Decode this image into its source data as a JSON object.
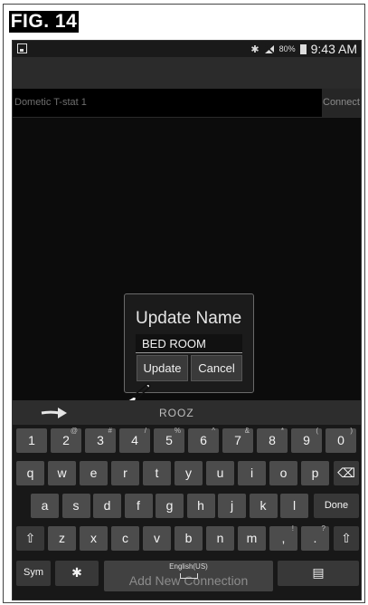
{
  "figure_label": "FIG. 14",
  "status_bar": {
    "battery": "80%",
    "time": "9:43 AM"
  },
  "device_list": {
    "device_name": "Dometic T-stat 1",
    "connect_label": "Connect"
  },
  "dialog": {
    "title": "Update Name",
    "input_value": "BED ROOM",
    "update_label": "Update",
    "cancel_label": "Cancel"
  },
  "suggestion": {
    "word": "ROOZ"
  },
  "keyboard": {
    "number_row": [
      {
        "key": "1",
        "sup": ""
      },
      {
        "key": "2",
        "sup": "@"
      },
      {
        "key": "3",
        "sup": "#"
      },
      {
        "key": "4",
        "sup": "/"
      },
      {
        "key": "5",
        "sup": "%"
      },
      {
        "key": "6",
        "sup": "^"
      },
      {
        "key": "7",
        "sup": "&"
      },
      {
        "key": "8",
        "sup": "*"
      },
      {
        "key": "9",
        "sup": "("
      },
      {
        "key": "0",
        "sup": ")"
      }
    ],
    "row1": [
      "q",
      "w",
      "e",
      "r",
      "t",
      "y",
      "u",
      "i",
      "o",
      "p"
    ],
    "row2": [
      "a",
      "s",
      "d",
      "f",
      "g",
      "h",
      "j",
      "k",
      "l"
    ],
    "row3": [
      "z",
      "x",
      "c",
      "v",
      "b",
      "n",
      "m"
    ],
    "row3_extra": [
      {
        "key": ",",
        "sup": "!"
      },
      {
        "key": ".",
        "sup": "?"
      }
    ],
    "done_label": "Done",
    "sym_label": "Sym",
    "space_language": "English(US)",
    "space_hint": "Add New Connection",
    "icons": {
      "backspace": "backspace-icon",
      "shift": "shift-icon",
      "settings": "gear-icon",
      "clipboard": "clipboard-icon"
    }
  }
}
